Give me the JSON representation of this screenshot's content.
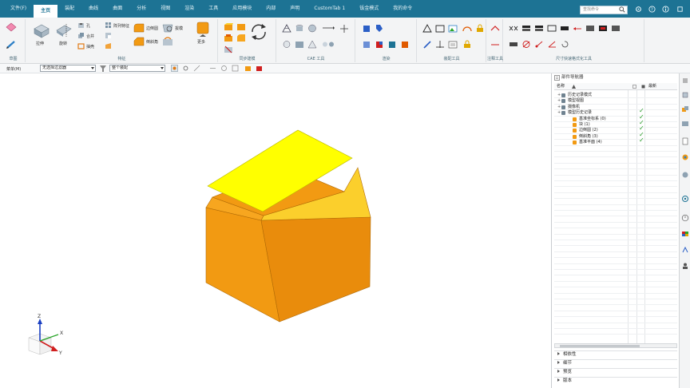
{
  "menubar": {
    "tabs": [
      {
        "label": "文件(F)",
        "active": false
      },
      {
        "label": "主页",
        "active": true
      },
      {
        "label": "装配",
        "active": false
      },
      {
        "label": "曲线",
        "active": false
      },
      {
        "label": "曲面",
        "active": false
      },
      {
        "label": "分析",
        "active": false
      },
      {
        "label": "视图",
        "active": false
      },
      {
        "label": "渲染",
        "active": false
      },
      {
        "label": "工具",
        "active": false
      },
      {
        "label": "应用模块",
        "active": false
      },
      {
        "label": "内部",
        "active": false
      },
      {
        "label": "声明",
        "active": false
      },
      {
        "label": "CustomTab 1",
        "active": false
      },
      {
        "label": "钣金模式",
        "active": false
      },
      {
        "label": "我的命令",
        "active": false
      }
    ],
    "search_placeholder": "查找命令"
  },
  "ribbon": {
    "groups": [
      {
        "label": "草图"
      },
      {
        "label": "特征"
      },
      {
        "label": "同步建模"
      },
      {
        "label": "CAE 工具"
      },
      {
        "label": "渲染"
      },
      {
        "label": "装配工具"
      },
      {
        "label": "注释工具"
      },
      {
        "label": "尺寸快速格式化工具"
      }
    ],
    "feature_buttons": [
      {
        "label": "拉伸"
      },
      {
        "label": "旋转"
      },
      {
        "label": "孔"
      },
      {
        "label": "阵列特征"
      },
      {
        "label": "合并"
      },
      {
        "label": "抽壳"
      },
      {
        "label": "边倒圆"
      },
      {
        "label": "倒斜角"
      },
      {
        "label": "拔模"
      },
      {
        "label": "更多"
      }
    ]
  },
  "selection_bar": {
    "menu_label": "菜单(M)",
    "filter_value": "无选择过滤器",
    "scope_value": "整个装配"
  },
  "navigator": {
    "title": "部件导航器",
    "columns": {
      "name": "名称",
      "latest": "最新"
    },
    "rows": [
      {
        "label": "历史记录模式",
        "indent": 0,
        "check": false
      },
      {
        "label": "模型视图",
        "indent": 0,
        "check": false
      },
      {
        "label": "摄像机",
        "indent": 0,
        "check": false
      },
      {
        "label": "模型历史记录",
        "indent": 0,
        "check": true
      },
      {
        "label": "基准坐标系 (0)",
        "indent": 1,
        "check": true
      },
      {
        "label": "块 (1)",
        "indent": 1,
        "check": true
      },
      {
        "label": "边倒圆 (2)",
        "indent": 1,
        "check": true
      },
      {
        "label": "倒斜角 (3)",
        "indent": 1,
        "check": true
      },
      {
        "label": "基准平面 (4)",
        "indent": 1,
        "check": true
      }
    ],
    "sections": [
      {
        "label": "相依性"
      },
      {
        "label": "细节"
      },
      {
        "label": "预览"
      },
      {
        "label": "版本"
      }
    ]
  },
  "viewport": {
    "axis_labels": {
      "x": "X",
      "y": "Y",
      "z": "Z"
    },
    "colors": {
      "part_front": "#e98c0c",
      "part_left": "#f29a12",
      "part_top": "#f7a61f",
      "part_chamfer": "#fbcf2c",
      "datum_plane": "#ffff00",
      "z_axis": "#1a3fc2",
      "y_axis": "#d01f1f",
      "x_axis": "#2aa62a"
    }
  }
}
